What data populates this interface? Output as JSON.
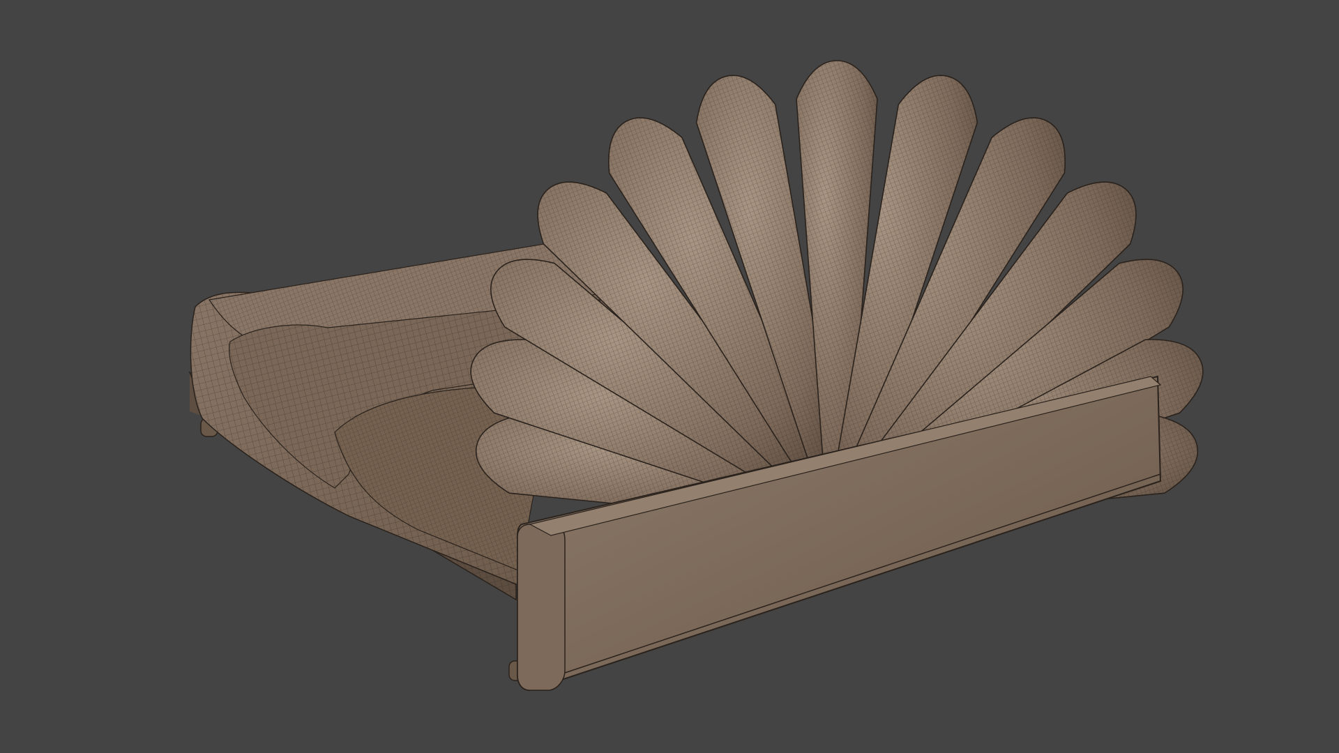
{
  "viewport": {
    "background_color": "#444444"
  },
  "model": {
    "subject": "bed-with-shell-headboard",
    "display_mode": "shaded-wireframe",
    "colors": {
      "fabric_base": "#7d6b5c",
      "fabric_light": "#a39182",
      "fabric_dark": "#4a3d33",
      "wire": "#2a221c",
      "base_panel": "#7b6858",
      "base_panel_light": "#8e7b6b"
    },
    "headboard_lobe_count": 13
  }
}
